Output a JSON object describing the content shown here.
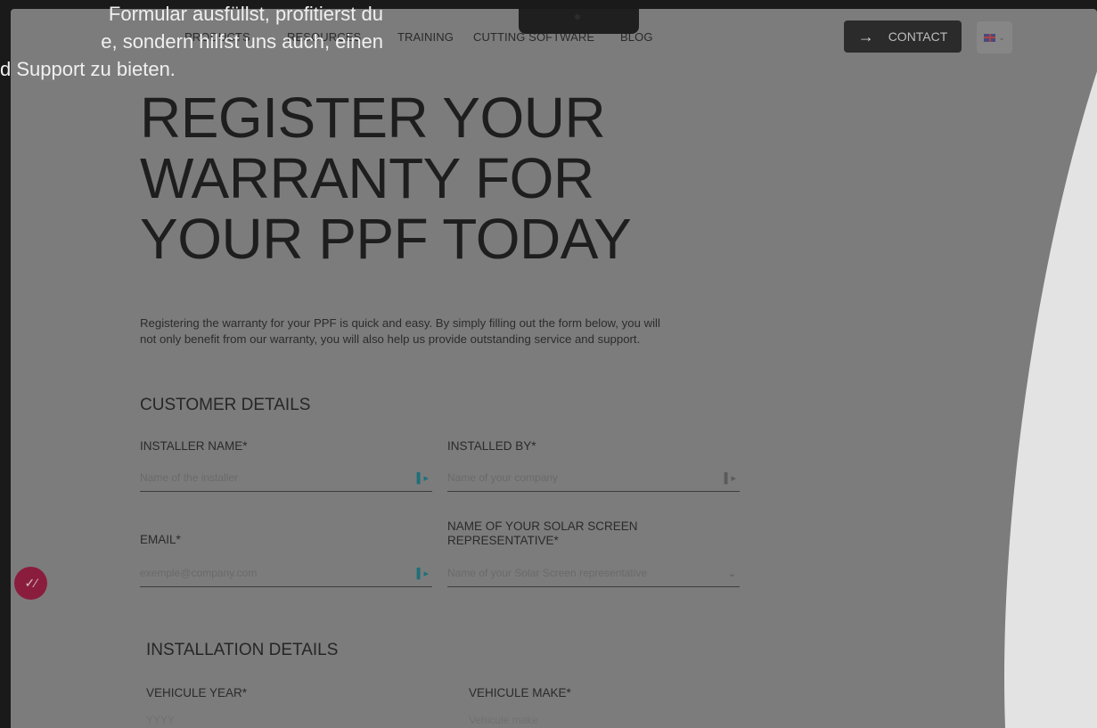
{
  "overlay": {
    "lines": [
      "Formular ausfüllst, profitierst du",
      "e, sondern hilfst uns auch, einen",
      "d Support zu bieten."
    ]
  },
  "nav": {
    "links": [
      "PRODUCTS",
      "RESOURCES",
      "TRAINING",
      "CUTTING SOFTWARE",
      "BLOG"
    ],
    "contact_label": "CONTACT",
    "contact_icon": "arrow-right-icon",
    "language_icon": "uk-flag-icon"
  },
  "page": {
    "title_lines": [
      "REGISTER YOUR",
      "WARRANTY FOR",
      "YOUR PPF TODAY"
    ],
    "intro_lines": [
      "Registering the warranty for your PPF is quick and easy. By simply filling out the form below, you will",
      "not only benefit from our warranty, you will also help us provide outstanding service and support."
    ]
  },
  "customer": {
    "heading": "CUSTOMER DETAILS",
    "installer_name": {
      "label": "INSTALLER NAME*",
      "placeholder": "Name of the installer"
    },
    "installed_by": {
      "label": "INSTALLED BY*",
      "placeholder": "Name of your company"
    },
    "email": {
      "label": "EMAIL*",
      "placeholder": "exemple@company.com"
    },
    "representative": {
      "label_lines": [
        "NAME OF YOUR SOLAR SCREEN",
        "REPRESENTATIVE*"
      ],
      "placeholder": "Name of your Solar Screen representative"
    }
  },
  "installation": {
    "heading": "INSTALLATION DETAILS",
    "year": {
      "label": "VEHICULE YEAR*",
      "placeholder": "YYYY"
    },
    "make": {
      "label": "VEHICULE MAKE*",
      "placeholder": "Vehicule make"
    }
  },
  "colors": {
    "overlay": "#7c7c7c",
    "accent_bubble": "#8a1d3d",
    "right_panel": "#e3e3e3"
  }
}
